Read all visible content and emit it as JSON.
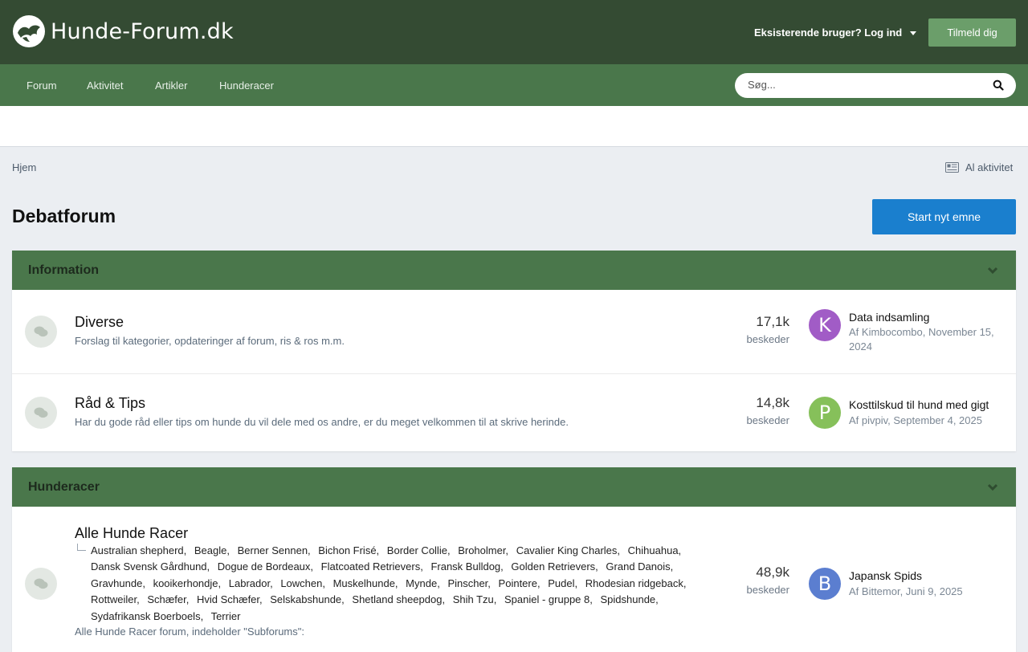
{
  "header": {
    "brand": "Hunde-Forum.dk",
    "login_label": "Eksisterende bruger? Log ind",
    "signup_label": "Tilmeld dig"
  },
  "nav": {
    "items": [
      "Forum",
      "Aktivitet",
      "Artikler",
      "Hunderacer"
    ]
  },
  "search": {
    "placeholder": "Søg..."
  },
  "breadcrumb": {
    "home": "Hjem",
    "all_activity": "Al aktivitet"
  },
  "page": {
    "title": "Debatforum",
    "start_topic_label": "Start nyt emne"
  },
  "colors": {
    "header_bg": "#344b33",
    "nav_bg": "#4a774b",
    "accent_button": "#1a7fce",
    "signup_button": "#6b9e6a"
  },
  "categories": [
    {
      "title": "Information",
      "forums": [
        {
          "title": "Diverse",
          "description": "Forslag til kategorier, opdateringer af forum, ris & ros m.m.",
          "posts": "17,1k",
          "posts_label": "beskeder",
          "last_post": {
            "avatar_letter": "K",
            "avatar_color": "#a15cc6",
            "title": "Data indsamling",
            "meta_line1": "Af Kimbocombo, November 15,",
            "meta_line2": "2024"
          }
        },
        {
          "title": "Råd & Tips",
          "description": "Har du gode råd eller tips om hunde du vil dele med os andre, er du meget velkommen til at skrive herinde.",
          "posts": "14,8k",
          "posts_label": "beskeder",
          "last_post": {
            "avatar_letter": "P",
            "avatar_color": "#86c05a",
            "title": "Kosttilskud til hund med gigt",
            "meta_line1": "Af pivpiv, September 4, 2025"
          }
        }
      ]
    },
    {
      "title": "Hunderacer",
      "forums": [
        {
          "title": "Alle Hunde Racer",
          "subforums": [
            "Australian shepherd,",
            "Beagle,",
            "Berner Sennen,",
            "Bichon Frisé,",
            "Border Collie,",
            "Broholmer,",
            "Cavalier King Charles,",
            "Chihuahua,",
            "Dansk Svensk Gårdhund,",
            "Dogue de Bordeaux,",
            "Flatcoated Retrievers,",
            "Fransk Bulldog,",
            "Golden Retrievers,",
            "Grand Danois,",
            "Gravhunde,",
            "kooikerhondje,",
            "Labrador,",
            "Lowchen,",
            "Muskelhunde,",
            "Mynde,",
            "Pinscher,",
            "Pointere,",
            "Pudel,",
            "Rhodesian ridgeback,",
            "Rottweiler,",
            "Schæfer,",
            "Hvid Schæfer,",
            "Selskabshunde,",
            "Shetland sheepdog,",
            "Shih Tzu,",
            "Spaniel - gruppe 8,",
            "Spidshunde,",
            "Sydafrikansk Boerboels,",
            "Terrier"
          ],
          "note": "Alle Hunde Racer forum, indeholder \"Subforums\":",
          "posts": "48,9k",
          "posts_label": "beskeder",
          "last_post": {
            "avatar_letter": "B",
            "avatar_color": "#5b7ed0",
            "title": "Japansk Spids",
            "meta_line1": "Af Bittemor, Juni 9, 2025"
          }
        }
      ]
    }
  ]
}
